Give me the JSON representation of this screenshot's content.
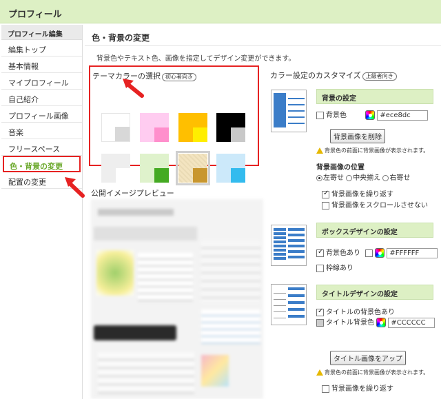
{
  "header": {
    "title": "プロフィール"
  },
  "sidebar": {
    "heading": "プロフィール編集",
    "items": [
      {
        "label": "編集トップ"
      },
      {
        "label": "基本情報"
      },
      {
        "label": "マイプロフィール"
      },
      {
        "label": "自己紹介"
      },
      {
        "label": "プロフィール画像"
      },
      {
        "label": "音楽"
      },
      {
        "label": "フリースペース"
      },
      {
        "label": "色・背景の変更",
        "active": true
      },
      {
        "label": "配置の変更"
      }
    ]
  },
  "main": {
    "heading": "色・背景の変更",
    "description": "背景色やテキスト色、画像を指定してデザイン変更ができます。",
    "theme": {
      "title": "テーマカラーの選択",
      "badge": "初心者向き",
      "swatches": [
        {
          "bg": "#ffffff",
          "accent": "#d8d8d8"
        },
        {
          "bg": "#ffccf0",
          "accent": "#ff8fcc"
        },
        {
          "bg": "#ffbf00",
          "accent": "#ffee00"
        },
        {
          "bg": "#000000",
          "accent": "#c8c8c8"
        },
        {
          "bg": "#eeeeee",
          "accent": "#ffffff"
        },
        {
          "bg": "#dff2cc",
          "accent": "#44aa22"
        },
        {
          "bg": "#f3e4c0",
          "accent": "#c8962e",
          "selected": true
        },
        {
          "bg": "#cce9fa",
          "accent": "#33bbee"
        }
      ]
    },
    "preview_label": "公開イメージプレビュー",
    "custom": {
      "title": "カラー設定のカスタマイズ",
      "badge": "上級者向き",
      "background": {
        "header": "背景の設定",
        "color_label": "背景色",
        "color_value": "#ece8dc",
        "delete_button": "背景画像を削除",
        "warning": "背景色の前面に背景画像が表示されます。",
        "position_label": "背景画像の位置",
        "positions": [
          "左寄せ",
          "中央揃え",
          "右寄せ"
        ],
        "repeat_label": "背景画像を繰り返す",
        "no_scroll_label": "背景画像をスクロールさせない"
      },
      "box": {
        "header": "ボックスデザインの設定",
        "bg_label": "背景色あり",
        "bg_value": "#FFFFFF",
        "border_label": "枠線あり"
      },
      "title_design": {
        "header": "タイトルデザインの設定",
        "bg_label": "タイトルの背景色あり",
        "bg_color_label": "タイトル背景色",
        "bg_color_value": "#CCCCCC",
        "upload_button": "タイトル画像をアップ",
        "warning": "背景色の前面に背景画像が表示されます。",
        "repeat_label": "背景画像を繰り返す"
      }
    }
  },
  "colors": {
    "accent_green": "#ddf0c4",
    "highlight_red": "#e62222"
  }
}
